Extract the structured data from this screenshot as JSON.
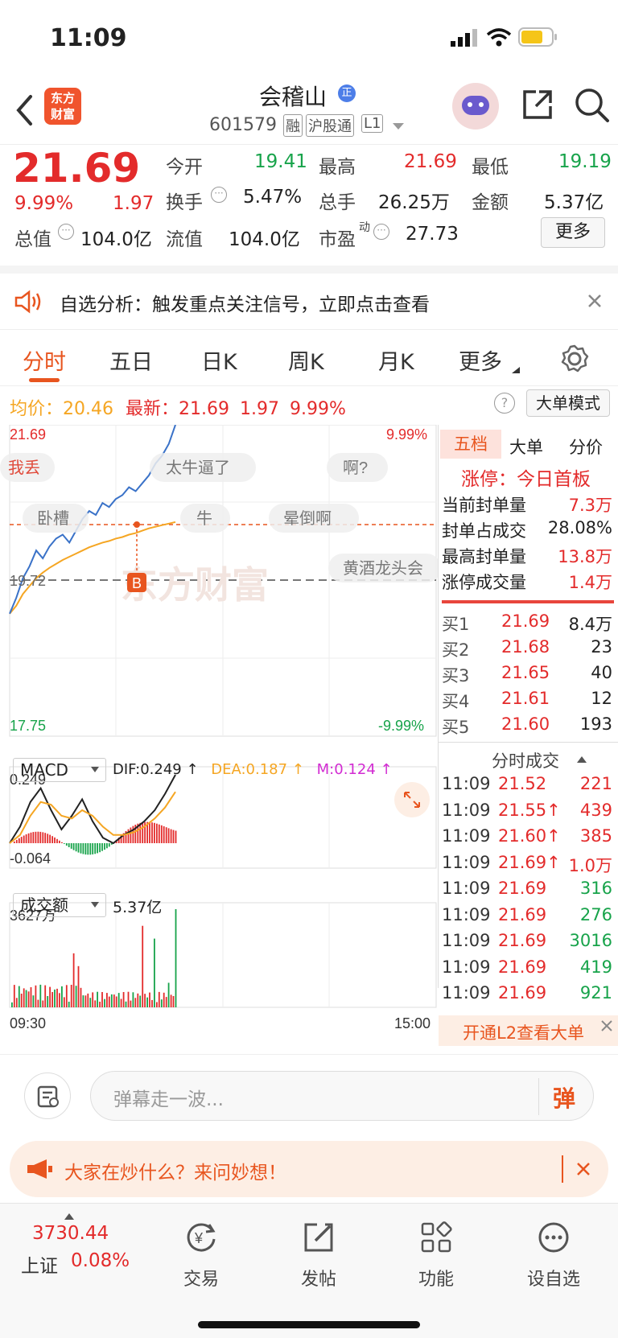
{
  "status_bar": {
    "time": "11:09"
  },
  "header": {
    "title": "会稽山",
    "title_badge": "正",
    "code": "601579",
    "tags": [
      "融",
      "沪股通",
      "L1"
    ],
    "logo_line1": "东方",
    "logo_line2": "财富",
    "colors": {
      "logo_bg": "#f0542d",
      "accent": "#e32b2b"
    }
  },
  "quote": {
    "price": "21.69",
    "change_pct": "9.99%",
    "change": "1.97",
    "fields": {
      "open_label": "今开",
      "open": "19.41",
      "high_label": "最高",
      "high": "21.69",
      "low_label": "最低",
      "low": "19.19",
      "turnover_label": "换手",
      "turnover": "5.47%",
      "volume_label": "总手",
      "volume": "26.25万",
      "amount_label": "金额",
      "amount": "5.37亿",
      "mktcap_label": "总值",
      "mktcap": "104.0亿",
      "float_label": "流值",
      "float": "104.0亿",
      "pe_label": "市盈",
      "pe_sup": "动",
      "pe": "27.73"
    },
    "more_button": "更多"
  },
  "alert": {
    "text": "自选分析：触发重点关注信号，立即点击查看"
  },
  "tabs": [
    "分时",
    "五日",
    "日K",
    "周K",
    "月K",
    "更多"
  ],
  "chart_info": {
    "avg_label": "均价：",
    "avg": "20.46",
    "latest_label": "最新：",
    "latest": "21.69",
    "latest_chg": "1.97",
    "latest_pct": "9.99%",
    "mode_button": "大单模式"
  },
  "chart_data": {
    "type": "line",
    "title": "",
    "y_top_label": "21.69",
    "y_mid_label": "19.72",
    "y_bottom_label": "17.75",
    "pct_top_label": "9.99%",
    "pct_bottom_label": "-9.99%",
    "x_start_label": "09:30",
    "x_end_label": "15:00",
    "ylim": [
      17.75,
      21.69
    ],
    "series": [
      {
        "values": [
          19.3,
          19.5,
          19.75,
          19.9,
          20.1,
          20.0,
          20.15,
          20.25,
          20.3,
          20.2,
          20.35,
          20.5,
          20.6,
          20.55,
          20.7,
          20.65,
          20.75,
          20.8,
          20.9,
          20.85,
          20.95,
          21.05,
          21.2,
          21.3,
          21.45,
          21.69
        ]
      },
      {
        "values": [
          19.3,
          19.4,
          19.55,
          19.65,
          19.75,
          19.82,
          19.88,
          19.93,
          19.98,
          20.02,
          20.06,
          20.1,
          20.14,
          20.17,
          20.2,
          20.22,
          20.25,
          20.27,
          20.3,
          20.32,
          20.35,
          20.38,
          20.4,
          20.42,
          20.44,
          20.46
        ]
      }
    ],
    "buy_marker": "B",
    "watermark": "东方财富",
    "danmaku": [
      "我丢",
      "太牛逼了",
      "啊?",
      "卧槽",
      "牛",
      "晕倒啊",
      "黄酒龙头会"
    ]
  },
  "macd": {
    "selector": "MACD",
    "dif_label": "DIF:0.249 ↑",
    "dea_label": "DEA:0.187 ↑",
    "m_label": "M:0.124 ↑",
    "top_label": "0.249",
    "bottom_label": "-0.064"
  },
  "volume": {
    "selector": "成交额",
    "total": "5.37亿",
    "max_label": "3627万"
  },
  "order_book": {
    "tabs": [
      "五档",
      "大单",
      "分价"
    ],
    "limit_title": "涨停：今日首板",
    "limit_rows": [
      {
        "label": "当前封单量",
        "value": "7.3万"
      },
      {
        "label": "封单占成交",
        "value": "28.08%"
      },
      {
        "label": "最高封单量",
        "value": "13.8万"
      },
      {
        "label": "涨停成交量",
        "value": "1.4万"
      }
    ],
    "bids": [
      {
        "label": "买1",
        "price": "21.69",
        "vol": "8.4万"
      },
      {
        "label": "买2",
        "price": "21.68",
        "vol": "23"
      },
      {
        "label": "买3",
        "price": "21.65",
        "vol": "40"
      },
      {
        "label": "买4",
        "price": "21.61",
        "vol": "12"
      },
      {
        "label": "买5",
        "price": "21.60",
        "vol": "193"
      }
    ],
    "ticks_title": "分时成交",
    "ticks": [
      {
        "time": "11:09",
        "price": "21.52",
        "vol": "221",
        "price_color": "red",
        "vol_color": "red"
      },
      {
        "time": "11:09",
        "price": "21.55↑",
        "vol": "439",
        "price_color": "red",
        "vol_color": "red"
      },
      {
        "time": "11:09",
        "price": "21.60↑",
        "vol": "385",
        "price_color": "red",
        "vol_color": "red"
      },
      {
        "time": "11:09",
        "price": "21.69↑",
        "vol": "1.0万",
        "price_color": "red",
        "vol_color": "red"
      },
      {
        "time": "11:09",
        "price": "21.69",
        "vol": "316",
        "price_color": "red",
        "vol_color": "green"
      },
      {
        "time": "11:09",
        "price": "21.69",
        "vol": "276",
        "price_color": "red",
        "vol_color": "green"
      },
      {
        "time": "11:09",
        "price": "21.69",
        "vol": "3016",
        "price_color": "red",
        "vol_color": "green"
      },
      {
        "time": "11:09",
        "price": "21.69",
        "vol": "419",
        "price_color": "red",
        "vol_color": "green"
      },
      {
        "time": "11:09",
        "price": "21.69",
        "vol": "921",
        "price_color": "red",
        "vol_color": "green"
      }
    ],
    "l2_banner": "开通L2查看大单"
  },
  "comment": {
    "placeholder": "弹幕走一波...",
    "send": "弹"
  },
  "promo": {
    "text": "大家在炒什么？来问妙想！"
  },
  "bottom_nav": {
    "index_value": "3730.44",
    "index_name": "上证",
    "index_pct": "0.08%",
    "items": [
      "交易",
      "发帖",
      "功能",
      "设自选"
    ]
  }
}
